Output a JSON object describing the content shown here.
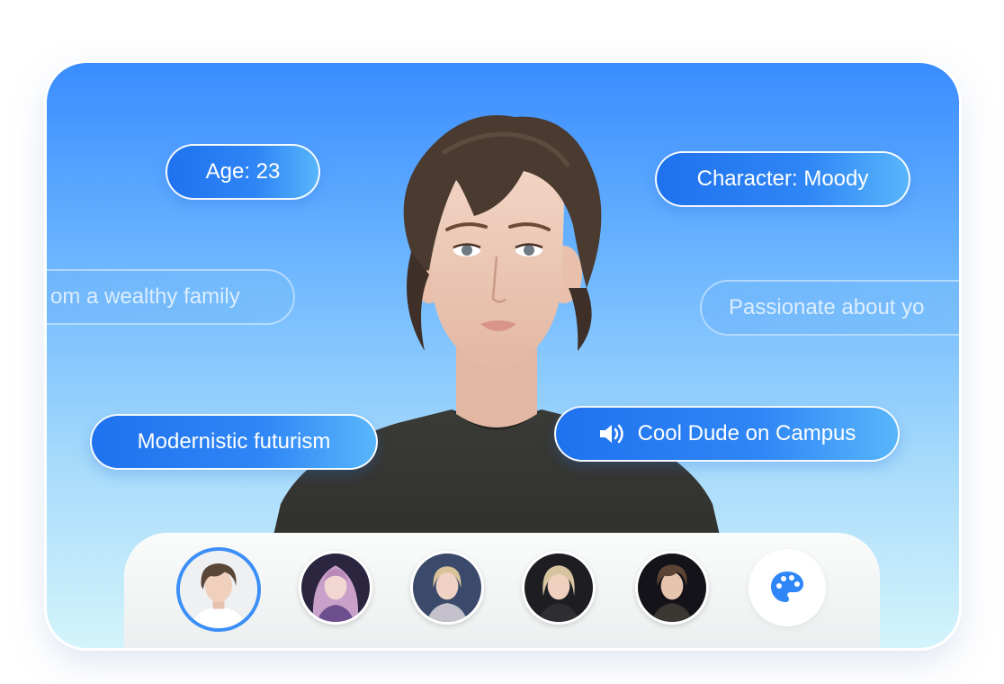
{
  "tags": {
    "age": "Age: 23",
    "character": "Character: Moody",
    "family": "om a wealthy family",
    "passion": "Passionate about yo",
    "style": "Modernistic futurism",
    "voice": "Cool Dude on Campus"
  },
  "colors": {
    "accent": "#2f86f6",
    "pill_start": "#1f72ee",
    "pill_end": "#58b6fb"
  },
  "avatars": [
    {
      "name": "avatar-1",
      "selected": true
    },
    {
      "name": "avatar-2",
      "selected": false
    },
    {
      "name": "avatar-3",
      "selected": false
    },
    {
      "name": "avatar-4",
      "selected": false
    },
    {
      "name": "avatar-5",
      "selected": false
    }
  ],
  "icons": {
    "voice": "speaker-icon",
    "customize": "palette-icon"
  }
}
